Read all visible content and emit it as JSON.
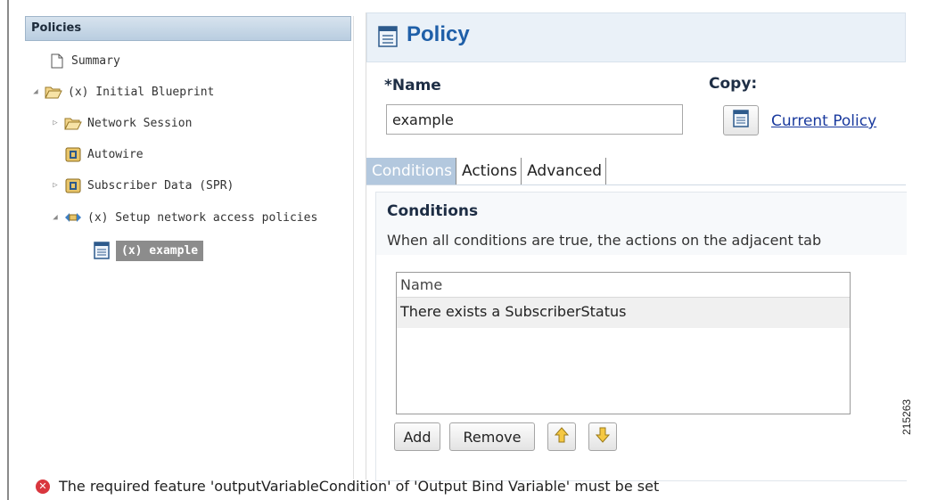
{
  "tree": {
    "header": "Policies",
    "items": [
      {
        "label": "Summary",
        "icon": "page-icon"
      },
      {
        "label": "(x) Initial Blueprint",
        "icon": "open-folder-icon",
        "expanded": true
      },
      {
        "label": "Network Session",
        "icon": "folder-icon",
        "expanded": false
      },
      {
        "label": "Autowire",
        "icon": "module-icon"
      },
      {
        "label": "Subscriber Data (SPR)",
        "icon": "module-icon",
        "expanded": false
      },
      {
        "label": "(x) Setup network access policies",
        "icon": "network-icon",
        "expanded": true
      },
      {
        "label": "(x) example",
        "icon": "policy-icon",
        "selected": true
      }
    ]
  },
  "editor": {
    "title": "Policy",
    "name_label": "*Name",
    "name_value": "example",
    "copy_label": "Copy:",
    "copy_link": "Current Policy",
    "tabs": [
      {
        "label": "Conditions",
        "active": true
      },
      {
        "label": "Actions"
      },
      {
        "label": "Advanced"
      }
    ],
    "conditions": {
      "title": "Conditions",
      "description": "When all conditions are true, the actions on the adjacent tab",
      "table_header": "Name",
      "rows": [
        "There exists a SubscriberStatus"
      ]
    },
    "buttons": {
      "add": "Add",
      "remove": "Remove"
    }
  },
  "error_message": "The required feature 'outputVariableCondition' of 'Output Bind Variable' must be set",
  "figure_number": "215263",
  "colors": {
    "title_blue": "#1f5fa8",
    "tab_active": "#b3c8de",
    "error_red": "#d9363e",
    "selection_gray": "#8c8c8c"
  }
}
